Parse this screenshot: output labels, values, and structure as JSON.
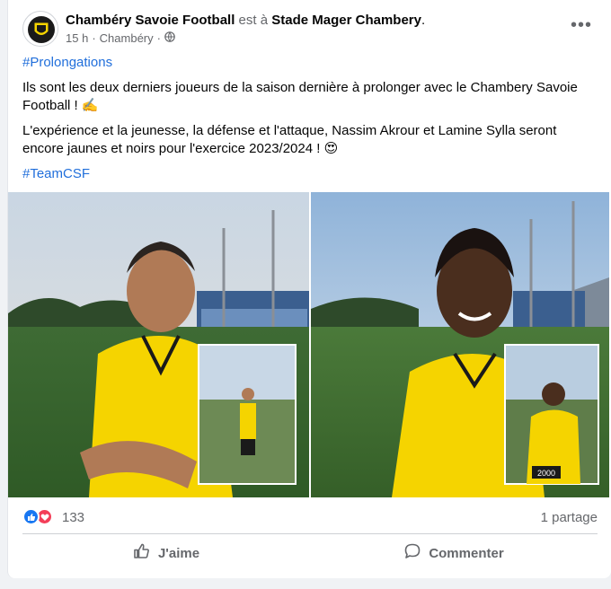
{
  "post": {
    "page_name": "Chambéry Savoie Football",
    "at_text": " est à ",
    "location": "Stade Mager Chambery",
    "period": ".",
    "time": "15 h",
    "place": "Chambéry",
    "separator": "·",
    "audience_icon": "globe-icon",
    "more_icon": "more-options-icon",
    "more_glyph": "•••"
  },
  "body": {
    "hashtag_top": "#Prolongations",
    "paragraph1": "Ils sont les deux derniers joueurs de la saison dernière à prolonger avec le Chambery Savoie Football ! ✍️",
    "paragraph2": "L'expérience et la jeunesse, la défense et l'attaque, Nassim Akrour et Lamine Sylla seront encore jaunes et noirs pour l'exercice 2023/2024 ! 😍",
    "hashtag_bottom": "#TeamCSF"
  },
  "photos": [
    {
      "subject": "player-1",
      "shirt_color": "#f5d400"
    },
    {
      "subject": "player-2",
      "shirt_color": "#f5d400",
      "badge_text": "2000"
    }
  ],
  "stats": {
    "reaction_count": "133",
    "shares": "1 partage",
    "like_color": "#1877f2",
    "love_color": "#f33e58"
  },
  "actions": {
    "like_label": "J'aime",
    "comment_label": "Commenter"
  }
}
